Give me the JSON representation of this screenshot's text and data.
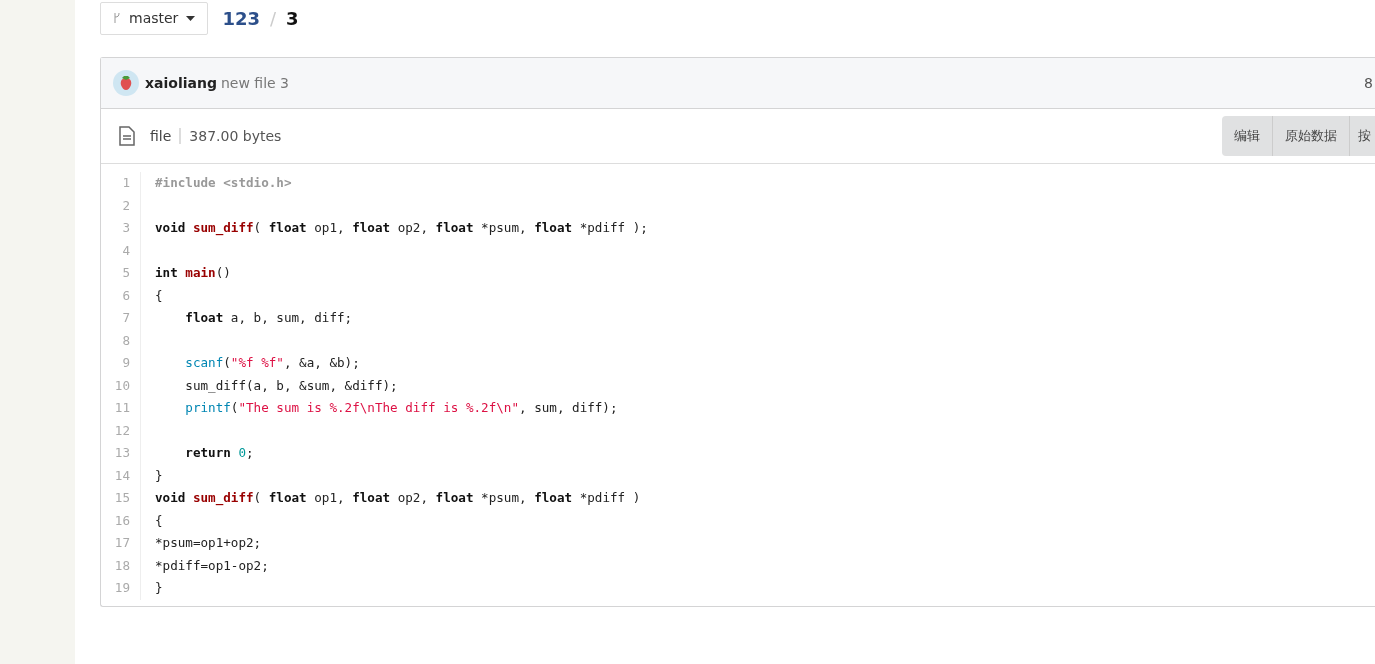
{
  "branch": {
    "label": "master"
  },
  "breadcrumb": [
    {
      "text": "123",
      "kind": "link"
    },
    {
      "text": "/",
      "kind": "separator"
    },
    {
      "text": "3",
      "kind": "current"
    }
  ],
  "commit": {
    "author": "xaioliang",
    "message": "new file 3",
    "extra": "8"
  },
  "file": {
    "type": "file",
    "size": "387.00 bytes",
    "buttons": [
      "编辑",
      "原始数据",
      "按"
    ]
  },
  "code": [
    {
      "number": "1",
      "tokens": [
        {
          "kind": "preprocessor",
          "text": "#include <stdio.h>"
        }
      ]
    },
    {
      "number": "2"
    },
    {
      "number": "3",
      "tokens": [
        {
          "kind": "keyword",
          "text": "void"
        },
        {
          "kind": "function",
          "text": " sum_diff"
        },
        {
          "kind": "plain",
          "text": "( "
        },
        {
          "kind": "keyword",
          "text": "float"
        },
        {
          "kind": "plain",
          "text": " op1, "
        },
        {
          "kind": "keyword",
          "text": "float"
        },
        {
          "kind": "plain",
          "text": " op2, "
        },
        {
          "kind": "keyword",
          "text": "float"
        },
        {
          "kind": "plain",
          "text": " *psum, "
        },
        {
          "kind": "keyword",
          "text": "float"
        },
        {
          "kind": "plain",
          "text": " *pdiff );"
        }
      ]
    },
    {
      "number": "4"
    },
    {
      "number": "5",
      "tokens": [
        {
          "kind": "keyword",
          "text": "int"
        },
        {
          "kind": "function",
          "text": " main"
        },
        {
          "kind": "plain",
          "text": "()"
        }
      ]
    },
    {
      "number": "6",
      "tokens": [
        {
          "kind": "plain",
          "text": "{"
        }
      ]
    },
    {
      "number": "7",
      "tokens": [
        {
          "kind": "keyword",
          "text": "    float"
        },
        {
          "kind": "plain",
          "text": " a, b, sum, diff;"
        }
      ]
    },
    {
      "number": "8"
    },
    {
      "number": "9",
      "tokens": [
        {
          "kind": "builtin",
          "text": "    scanf"
        },
        {
          "kind": "plain",
          "text": "("
        },
        {
          "kind": "string",
          "text": "\"%f %f\""
        },
        {
          "kind": "plain",
          "text": ", &a, &b);"
        }
      ]
    },
    {
      "number": "10",
      "tokens": [
        {
          "kind": "plain",
          "text": "    sum_diff(a, b, &sum, &diff);"
        }
      ]
    },
    {
      "number": "11",
      "tokens": [
        {
          "kind": "builtin",
          "text": "    printf"
        },
        {
          "kind": "plain",
          "text": "("
        },
        {
          "kind": "string",
          "text": "\"The sum is %.2f\\nThe diff is %.2f\\n\""
        },
        {
          "kind": "plain",
          "text": ", sum, diff);"
        }
      ]
    },
    {
      "number": "12"
    },
    {
      "number": "13",
      "tokens": [
        {
          "kind": "keyword",
          "text": "    return"
        },
        {
          "kind": "number",
          "text": " 0"
        },
        {
          "kind": "plain",
          "text": ";"
        }
      ]
    },
    {
      "number": "14",
      "tokens": [
        {
          "kind": "plain",
          "text": "}"
        }
      ]
    },
    {
      "number": "15",
      "tokens": [
        {
          "kind": "keyword",
          "text": "void"
        },
        {
          "kind": "function",
          "text": " sum_diff"
        },
        {
          "kind": "plain",
          "text": "( "
        },
        {
          "kind": "keyword",
          "text": "float"
        },
        {
          "kind": "plain",
          "text": " op1, "
        },
        {
          "kind": "keyword",
          "text": "float"
        },
        {
          "kind": "plain",
          "text": " op2, "
        },
        {
          "kind": "keyword",
          "text": "float"
        },
        {
          "kind": "plain",
          "text": " *psum, "
        },
        {
          "kind": "keyword",
          "text": "float"
        },
        {
          "kind": "plain",
          "text": " *pdiff )"
        }
      ]
    },
    {
      "number": "16",
      "tokens": [
        {
          "kind": "plain",
          "text": "{"
        }
      ]
    },
    {
      "number": "17",
      "tokens": [
        {
          "kind": "plain",
          "text": "*psum=op1+op2;"
        }
      ]
    },
    {
      "number": "18",
      "tokens": [
        {
          "kind": "plain",
          "text": "*pdiff=op1-op2;"
        }
      ]
    },
    {
      "number": "19",
      "tokens": [
        {
          "kind": "plain",
          "text": "}"
        }
      ]
    }
  ]
}
